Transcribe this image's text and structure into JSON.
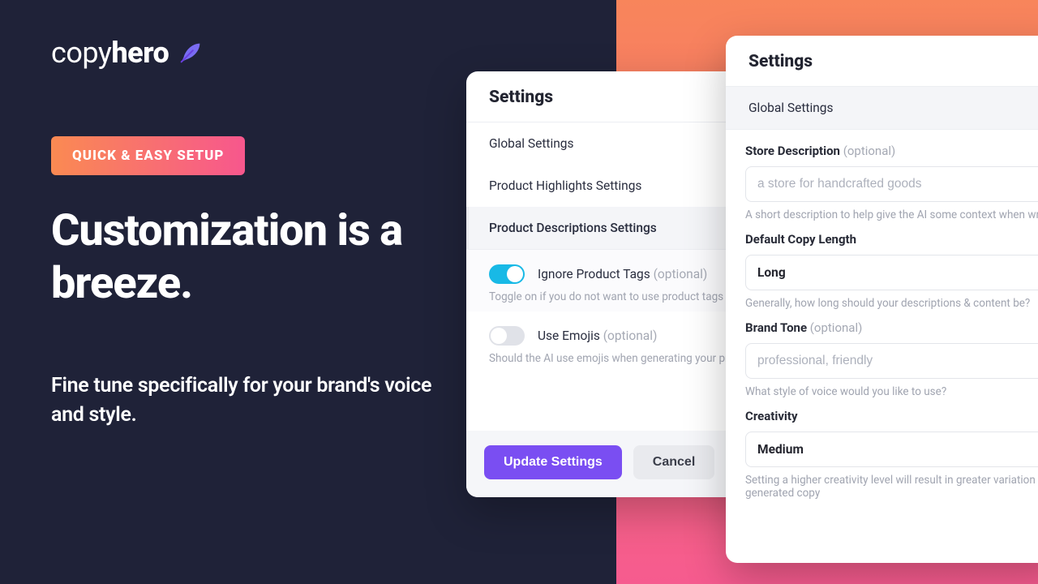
{
  "logo": {
    "part1": "copy",
    "part2": "hero"
  },
  "marketing": {
    "badge": "QUICK & EASY SETUP",
    "headline": "Customization is a breeze.",
    "subhead": "Fine tune specifically for your brand's voice and style."
  },
  "card_left": {
    "title": "Settings",
    "nav": [
      {
        "label": "Global Settings"
      },
      {
        "label": "Product Highlights Settings"
      },
      {
        "label": "Product Descriptions Settings"
      }
    ],
    "toggles": [
      {
        "label": "Ignore Product Tags",
        "optional": "(optional)",
        "hint": "Toggle on if you do not want to use product tags a",
        "on": true
      },
      {
        "label": "Use Emojis",
        "optional": "(optional)",
        "hint": "Should the AI use emojis when generating your pr",
        "on": false
      }
    ],
    "buttons": {
      "update": "Update Settings",
      "cancel": "Cancel"
    }
  },
  "card_right": {
    "title": "Settings",
    "section": "Global Settings",
    "store_desc": {
      "label": "Store Description",
      "optional": "(optional)",
      "placeholder": "a store for handcrafted goods",
      "hint": "A short description to help give the AI some context when wr"
    },
    "copy_length": {
      "label": "Default Copy Length",
      "value": "Long",
      "hint": "Generally, how long should your descriptions & content be?"
    },
    "brand_tone": {
      "label": "Brand Tone",
      "optional": "(optional)",
      "placeholder": "professional, friendly",
      "hint": "What style of voice would you like to use?"
    },
    "creativity": {
      "label": "Creativity",
      "value": "Medium",
      "hint": "Setting a higher creativity level will result in greater variation generated copy"
    }
  }
}
